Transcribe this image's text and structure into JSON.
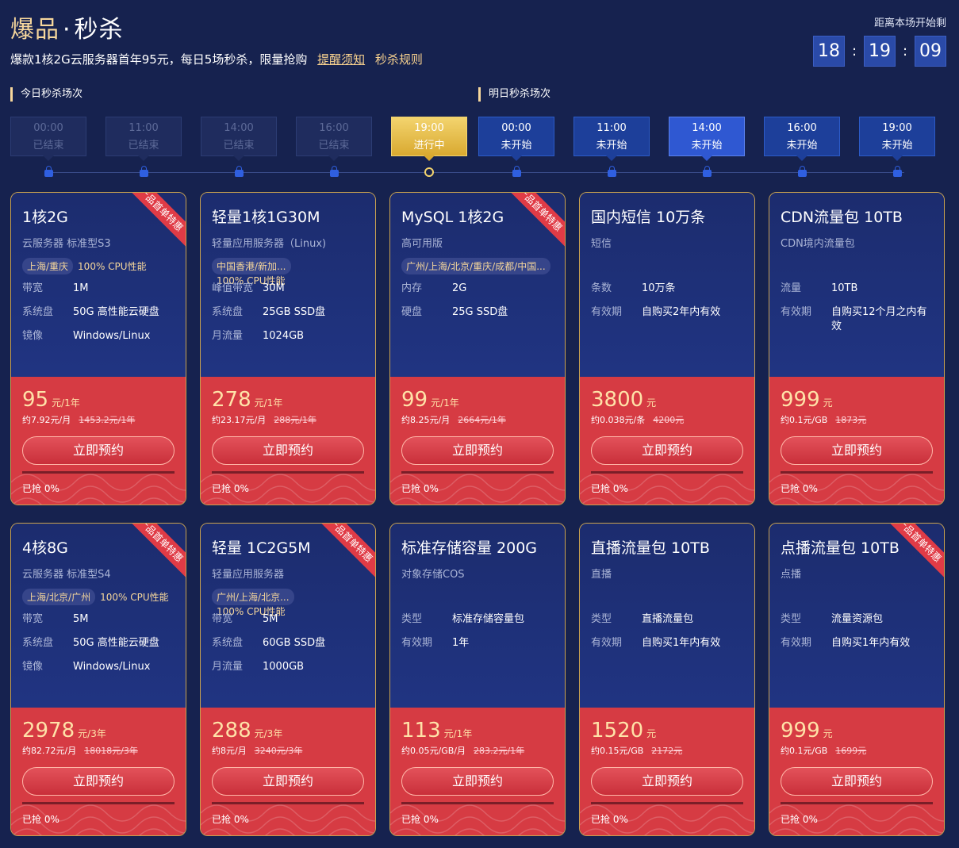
{
  "header": {
    "title_a": "爆品",
    "title_dot": "·",
    "title_b": "秒杀",
    "subtitle": "爆款1核2G云服务器首年95元，每日5场秒杀，限量抢购",
    "link_notice": "提醒须知",
    "link_rules": "秒杀规则"
  },
  "countdown": {
    "label": "距离本场开始剩",
    "h": "18",
    "m": "19",
    "s": "09",
    "sep": ":"
  },
  "sessions": {
    "today_label": "今日秒杀场次",
    "tomorrow_label": "明日秒杀场次"
  },
  "slots": [
    {
      "time": "00:00",
      "status": "已结束"
    },
    {
      "time": "11:00",
      "status": "已结束"
    },
    {
      "time": "14:00",
      "status": "已结束"
    },
    {
      "time": "16:00",
      "status": "已结束"
    },
    {
      "time": "19:00",
      "status": "进行中"
    },
    {
      "time": "00:00",
      "status": "未开始"
    },
    {
      "time": "11:00",
      "status": "未开始"
    },
    {
      "time": "14:00",
      "status": "未开始"
    },
    {
      "time": "16:00",
      "status": "未开始"
    },
    {
      "time": "19:00",
      "status": "未开始"
    }
  ],
  "ribbon_text": "产品首单特惠",
  "buy_label": "立即预约",
  "cards": [
    {
      "name": "1核2G",
      "sub": "云服务器 标准型S3",
      "tag": "上海/重庆",
      "tag2": "100% CPU性能",
      "specs": [
        {
          "k": "带宽",
          "v": "1M"
        },
        {
          "k": "系统盘",
          "v": "50G 高性能云硬盘"
        },
        {
          "k": "镜像",
          "v": "Windows/Linux"
        }
      ],
      "price": "95",
      "unit": "元/1年",
      "per": "约7.92元/月",
      "orig": "1453.2元/1年",
      "sold": "已抢 0%"
    },
    {
      "name": "轻量1核1G30M",
      "sub": "轻量应用服务器（Linux)",
      "tag": "中国香港/新加...",
      "tag_under": "100% CPU性能",
      "specs": [
        {
          "k": "峰值带宽",
          "v": "30M"
        },
        {
          "k": "系统盘",
          "v": "25GB SSD盘"
        },
        {
          "k": "月流量",
          "v": "1024GB"
        }
      ],
      "price": "278",
      "unit": "元/1年",
      "per": "约23.17元/月",
      "orig": "288元/1年",
      "sold": "已抢 0%"
    },
    {
      "name": "MySQL 1核2G",
      "sub": "高可用版",
      "tag": "广州/上海/北京/重庆/成都/中国...",
      "specs": [
        {
          "k": "内存",
          "v": "2G"
        },
        {
          "k": "硬盘",
          "v": "25G SSD盘"
        }
      ],
      "price": "99",
      "unit": "元/1年",
      "per": "约8.25元/月",
      "orig": "2664元/1年",
      "sold": "已抢 0%"
    },
    {
      "name": "国内短信 10万条",
      "sub": "短信",
      "specs": [
        {
          "k": "条数",
          "v": "10万条"
        },
        {
          "k": "有效期",
          "v": "自购买2年内有效"
        }
      ],
      "price": "3800",
      "unit": "元",
      "per": "约0.038元/条",
      "orig": "4200元",
      "sold": "已抢 0%"
    },
    {
      "name": "CDN流量包 10TB",
      "sub": "CDN境内流量包",
      "specs": [
        {
          "k": "流量",
          "v": "10TB"
        },
        {
          "k": "有效期",
          "v": "自购买12个月之内有效"
        }
      ],
      "price": "999",
      "unit": "元",
      "per": "约0.1元/GB",
      "orig": "1873元",
      "sold": "已抢 0%"
    },
    {
      "name": "4核8G",
      "sub": "云服务器 标准型S4",
      "tag": "上海/北京/广州",
      "tag2": "100% CPU性能",
      "specs": [
        {
          "k": "带宽",
          "v": "5M"
        },
        {
          "k": "系统盘",
          "v": "50G 高性能云硬盘"
        },
        {
          "k": "镜像",
          "v": "Windows/Linux"
        }
      ],
      "price": "2978",
      "unit": "元/3年",
      "per": "约82.72元/月",
      "orig": "18018元/3年",
      "sold": "已抢 0%"
    },
    {
      "name": "轻量 1C2G5M",
      "sub": "轻量应用服务器",
      "tag": "广州/上海/北京...",
      "tag_under": "100% CPU性能",
      "specs": [
        {
          "k": "带宽",
          "v": "5M"
        },
        {
          "k": "系统盘",
          "v": "60GB SSD盘"
        },
        {
          "k": "月流量",
          "v": "1000GB"
        }
      ],
      "price": "288",
      "unit": "元/3年",
      "per": "约8元/月",
      "orig": "3240元/3年",
      "sold": "已抢 0%"
    },
    {
      "name": "标准存储容量 200G",
      "sub": "对象存储COS",
      "specs": [
        {
          "k": "类型",
          "v": "标准存储容量包"
        },
        {
          "k": "有效期",
          "v": "1年"
        }
      ],
      "price": "113",
      "unit": "元/1年",
      "per": "约0.05元/GB/月",
      "orig": "283.2元/1年",
      "sold": "已抢 0%"
    },
    {
      "name": "直播流量包 10TB",
      "sub": "直播",
      "specs": [
        {
          "k": "类型",
          "v": "直播流量包"
        },
        {
          "k": "有效期",
          "v": "自购买1年内有效"
        }
      ],
      "price": "1520",
      "unit": "元",
      "per": "约0.15元/GB",
      "orig": "2172元",
      "sold": "已抢 0%"
    },
    {
      "name": "点播流量包 10TB",
      "sub": "点播",
      "specs": [
        {
          "k": "类型",
          "v": "流量资源包"
        },
        {
          "k": "有效期",
          "v": "自购买1年内有效"
        }
      ],
      "price": "999",
      "unit": "元",
      "per": "约0.1元/GB",
      "orig": "1699元",
      "sold": "已抢 0%"
    }
  ]
}
